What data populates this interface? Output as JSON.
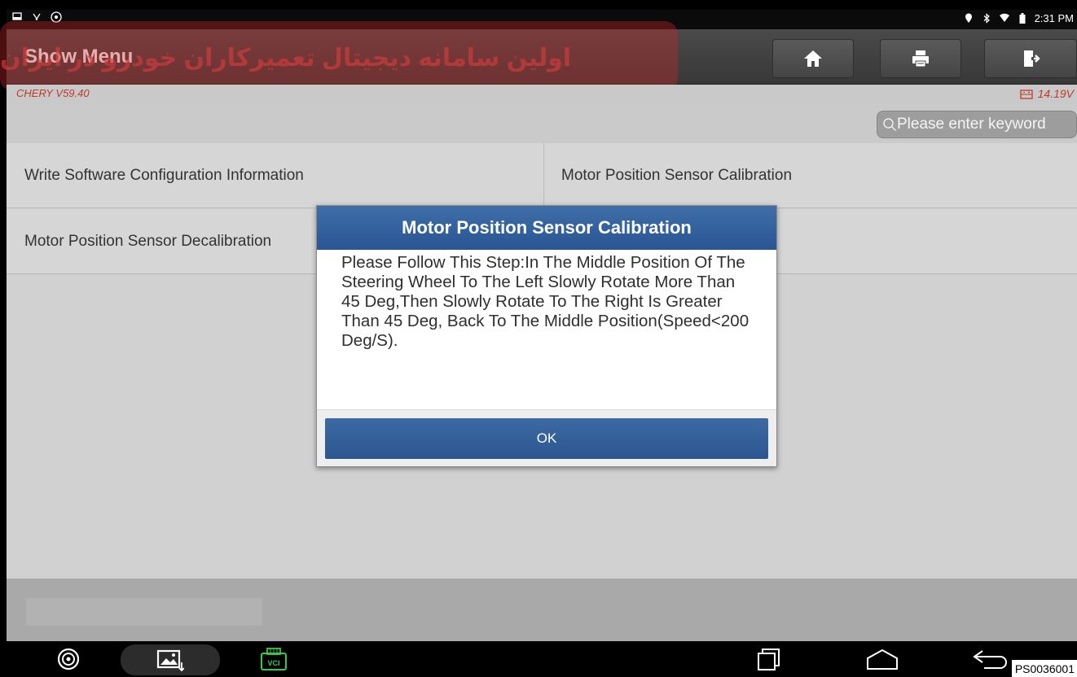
{
  "status_bar": {
    "time": "2:31 PM",
    "icons_left": [
      "screenshot-icon",
      "usb-debug-icon",
      "steering-icon"
    ],
    "icons_right": [
      "location-icon",
      "bluetooth-icon",
      "wifi-icon",
      "battery-icon"
    ]
  },
  "header": {
    "menu_label": "Show Menu",
    "buttons": [
      "home-icon",
      "print-icon",
      "exit-icon"
    ]
  },
  "watermark": {
    "text": "اولین سامانه دیجیتال تعمیرکاران خودرو در ایران"
  },
  "version_bar": {
    "version": "CHERY V59.40",
    "voltage": "14.19V"
  },
  "search": {
    "placeholder": "Please enter keyword"
  },
  "menu_items": [
    "Write Software Configuration Information",
    "Motor Position Sensor Calibration",
    "Motor Position Sensor Decalibration"
  ],
  "dialog": {
    "title": "Motor Position Sensor Calibration",
    "message": "Please Follow This Step:In The Middle Position Of The Steering Wheel To The Left Slowly Rotate More Than 45 Deg,Then Slowly Rotate To The Right Is Greater Than 45 Deg, Back To The Middle Position(Speed<200 Deg/S).",
    "ok_label": "OK"
  },
  "nav_bar": {
    "vci_label": "VCI",
    "code": "PS0036001"
  },
  "colors": {
    "dialog_header": "#2f5c98",
    "version_text": "#c0392b",
    "content_bg": "#d1d1d1"
  }
}
